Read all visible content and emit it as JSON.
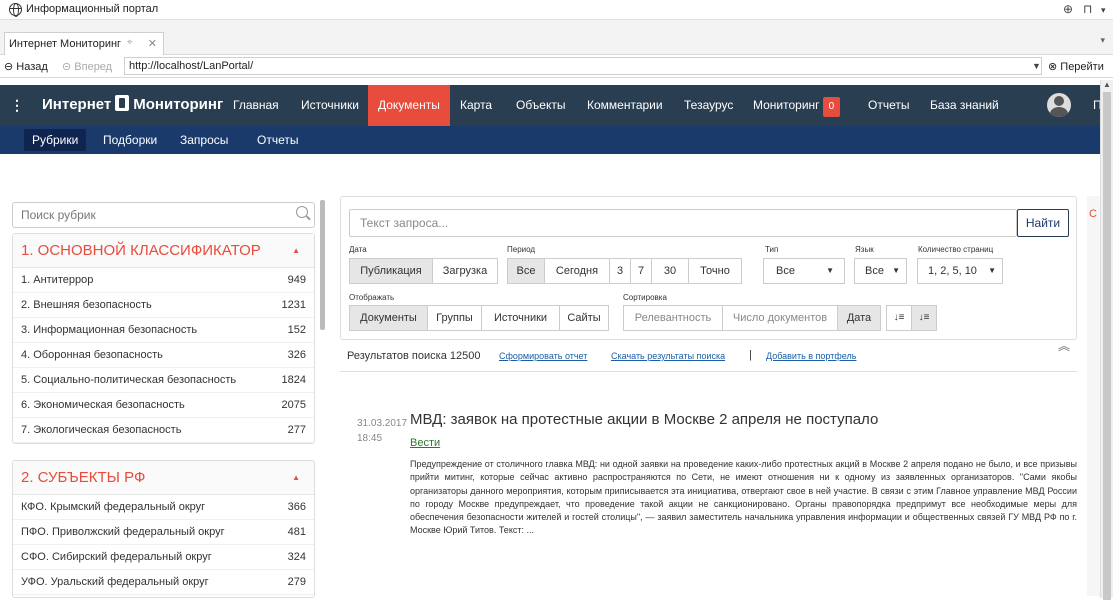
{
  "window": {
    "title": "Информационный портал",
    "controls": [
      "⊕",
      "⊓",
      "▾"
    ]
  },
  "tab": {
    "label": "Интернет Мониторинг",
    "pin": "⌖",
    "close": "✕",
    "menu": "▾"
  },
  "address": {
    "back": "Назад",
    "forward": "Вперед",
    "url": "http://localhost/LanPortal/",
    "go": "Перейти"
  },
  "brand": {
    "left": "Интернет",
    "right": "Мониторинг"
  },
  "nav": [
    {
      "label": "Главная"
    },
    {
      "label": "Источники"
    },
    {
      "label": "Документы",
      "active": true
    },
    {
      "label": "Карта"
    },
    {
      "label": "Объекты"
    },
    {
      "label": "Комментарии"
    },
    {
      "label": "Тезаурус"
    },
    {
      "label": "Мониторинг",
      "badge": "0"
    },
    {
      "label": "Отчеты"
    },
    {
      "label": "База знаний"
    }
  ],
  "nav_extra": "П",
  "subnav": [
    {
      "label": "Рубрики",
      "active": true
    },
    {
      "label": "Подборки"
    },
    {
      "label": "Запросы"
    },
    {
      "label": "Отчеты"
    }
  ],
  "sidebar": {
    "search_placeholder": "Поиск рубрик",
    "groups": [
      {
        "title": "1. ОСНОВНОЙ КЛАССИФИКАТОР",
        "items": [
          {
            "label": "1. Антитеррор",
            "count": "949"
          },
          {
            "label": "2. Внешняя безопасность",
            "count": "1231"
          },
          {
            "label": "3. Информационная безопасность",
            "count": "152"
          },
          {
            "label": "4. Оборонная безопасность",
            "count": "326"
          },
          {
            "label": "5. Социально-политическая безопасность",
            "count": "1824"
          },
          {
            "label": "6. Экономическая безопасность",
            "count": "2075"
          },
          {
            "label": "7. Экологическая безопасность",
            "count": "277"
          }
        ]
      },
      {
        "title": "2. СУБЪЕКТЫ РФ",
        "items": [
          {
            "label": "КФО. Крымский федеральный округ",
            "count": "366"
          },
          {
            "label": "ПФО. Приволжский федеральный округ",
            "count": "481"
          },
          {
            "label": "СФО. Сибирский федеральный округ",
            "count": "324"
          },
          {
            "label": "УФО. Уральский федеральный округ",
            "count": "279"
          }
        ]
      }
    ]
  },
  "query": {
    "placeholder": "Текст запроса...",
    "find": "Найти"
  },
  "filters": {
    "date_label": "Дата",
    "date_opts": [
      "Публикация",
      "Загрузка"
    ],
    "period_label": "Период",
    "period_opts": [
      "Все",
      "Сегодня",
      "3",
      "7",
      "30",
      "Точно"
    ],
    "type_label": "Тип",
    "type_value": "Все",
    "lang_label": "Язык",
    "lang_value": "Все",
    "pages_label": "Количество страниц",
    "pages_value": "1, 2, 5, 10",
    "display_label": "Отображать",
    "display_opts": [
      "Документы",
      "Группы",
      "Источники",
      "Сайты"
    ],
    "sort_label": "Сортировка",
    "sort_opts": [
      "Релевантность",
      "Число документов",
      "Дата"
    ],
    "sort_icons": [
      "↓≡",
      "↓≡"
    ]
  },
  "results": {
    "text": "Результатов поиска 12500",
    "links": [
      "Сформировать отчет",
      "Скачать результаты поиска",
      "Добавить в портфель"
    ],
    "divider": "|"
  },
  "article": {
    "date": "31.03.2017",
    "time": "18:45",
    "title": "МВД: заявок на протестные акции в Москве 2 апреля не поступало",
    "source": "Вести",
    "body": "Предупреждение от столичного главка МВД: ни одной заявки на проведение каких-либо протестных акций в Москве 2 апреля подано не было, и все призывы прийти митинг, которые сейчас активно распространяются по Сети, не имеют отношения ни к одному из заявленных организаторов. \"Сами якобы организаторы данного мероприятия, которым приписывается эта инициатива, отвергают свое в ней участие. В связи с этим Главное управление МВД России по городу Москве предупреждает, что проведение такой акции не санкционировано. Органы правопорядка предпримут все необходимые меры для обеспечения безопасности жителей и гостей столицы\", — заявил заместитель начальника управления информации и общественных связей ГУ МВД РФ по г. Москве Юрий Титов. Текст: ..."
  },
  "right_stub": "С"
}
